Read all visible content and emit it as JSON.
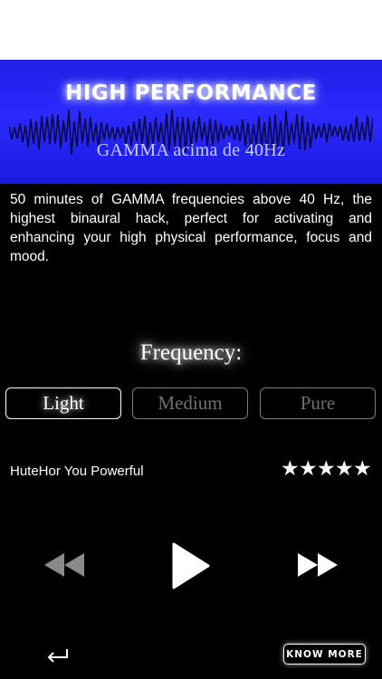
{
  "banner": {
    "title": "HIGH PERFORMANCE",
    "subtitle": "GAMMA acima de 40Hz"
  },
  "description": "50 minutes of GAMMA frequencies above 40 Hz, the highest binaural hack, perfect for activating and enhancing your high physical performance, focus and mood.",
  "frequency": {
    "heading": "Frequency:",
    "options": [
      "Light",
      "Medium",
      "Pure"
    ],
    "selected": "Light"
  },
  "track": {
    "title": "HuteHor You Powerful",
    "rating": 5
  },
  "controls": {
    "rewind_icon": "rewind-icon",
    "play_icon": "play-icon",
    "forward_icon": "fast-forward-icon",
    "back_icon": "return-arrow-icon"
  },
  "know_more_label": "KNOW MORE",
  "colors": {
    "banner": "#2a2aff",
    "background": "#000000",
    "inactive": "#6f6f6f",
    "rewind": "#8a8a8a"
  }
}
